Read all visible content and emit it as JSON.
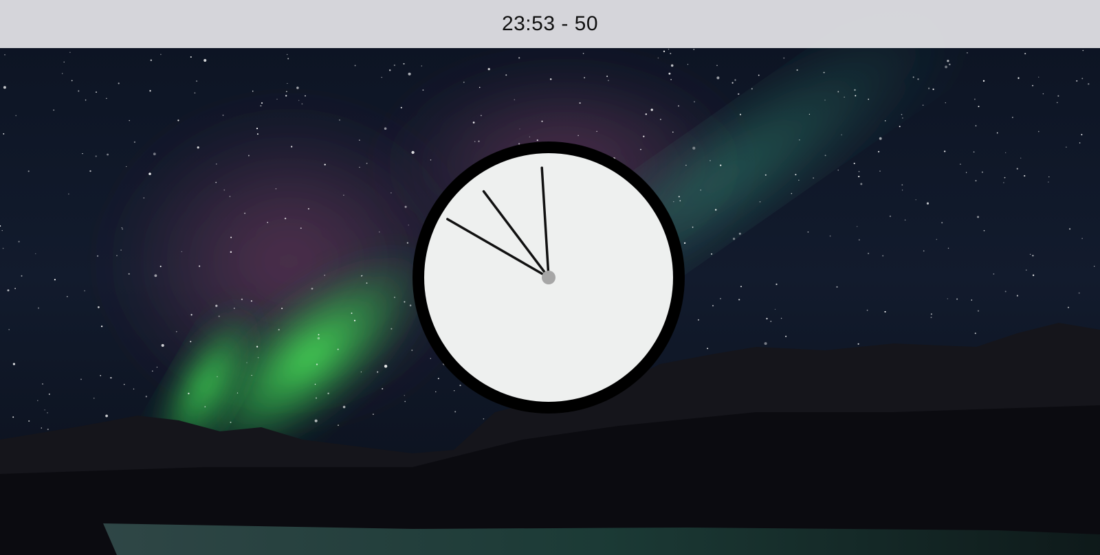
{
  "header": {
    "time_display": "23:53 - 50"
  },
  "clock": {
    "hours": 23,
    "minutes": 53,
    "seconds": 50,
    "face_color": "#eef0ef",
    "rim_color": "#000000",
    "hand_color": "#111111",
    "hub_color": "#a6a6a6"
  },
  "background": {
    "description_icon": "aurora-night-landscape",
    "sky_color": "#0f1626",
    "aurora_green": "#3fe04a",
    "aurora_teal": "#2f9a78",
    "aurora_purple": "#5a3252",
    "mountain_color": "#0d0d12",
    "lake_color": "#1c3b37"
  }
}
